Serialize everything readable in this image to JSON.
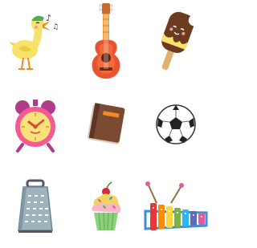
{
  "board": {
    "items": [
      {
        "icon": "singing-duck-icon"
      },
      {
        "icon": "guitar-icon"
      },
      {
        "icon": "ice-cream-bar-icon"
      },
      {
        "icon": "alarm-clock-icon"
      },
      {
        "icon": "book-icon"
      },
      {
        "icon": "soccer-ball-icon"
      },
      {
        "icon": "grater-icon"
      },
      {
        "icon": "cupcake-icon"
      },
      {
        "icon": "xylophone-icon"
      }
    ]
  },
  "colors": {
    "background": "#ffffff",
    "duck": "#f7e36a",
    "guitar": "#e8542f",
    "popsicle": "#6b3a1f",
    "clock": "#f25c93",
    "book": "#7a4a32",
    "grater": "#9fb3bf",
    "cupcake": "#f7b6c8",
    "xylophone": "#3c8fd6"
  }
}
